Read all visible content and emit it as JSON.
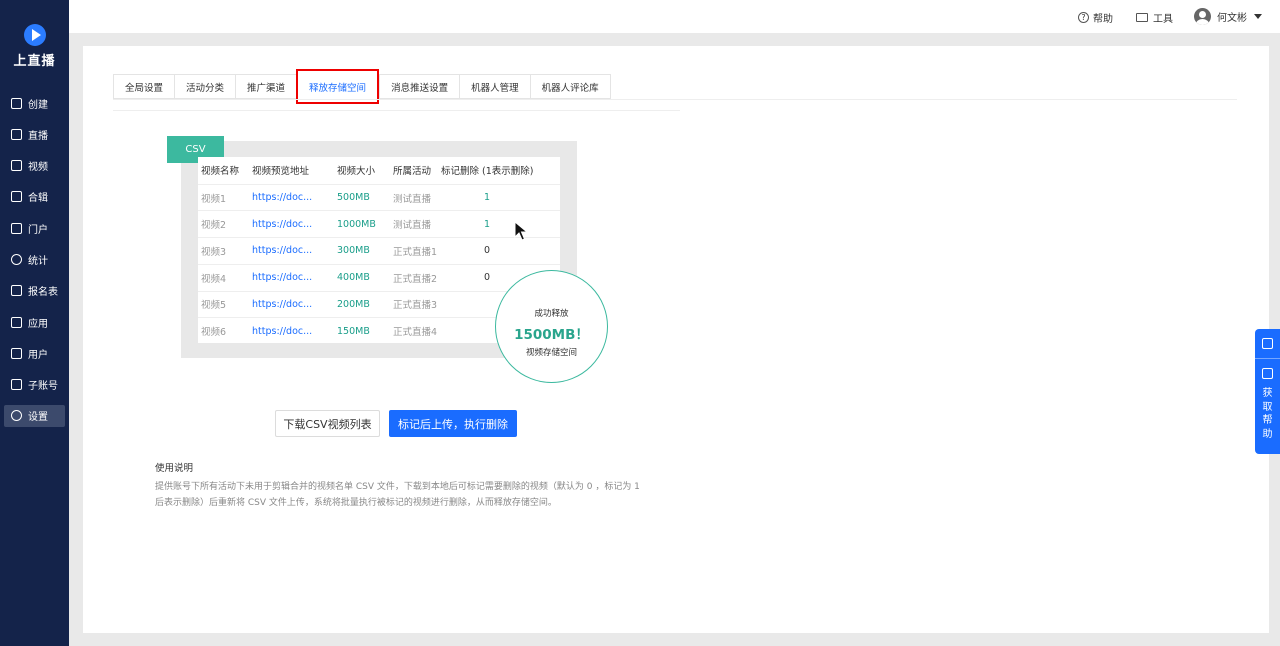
{
  "app": {
    "logo_text": "上直播"
  },
  "sidebar": {
    "items": [
      {
        "label": "创建",
        "icon": "plus-square-icon"
      },
      {
        "label": "直播",
        "icon": "video-camera-icon"
      },
      {
        "label": "视频",
        "icon": "film-icon"
      },
      {
        "label": "合辑",
        "icon": "collection-icon"
      },
      {
        "label": "门户",
        "icon": "monitor-icon"
      },
      {
        "label": "统计",
        "icon": "pie-chart-icon"
      },
      {
        "label": "报名表",
        "icon": "form-icon"
      },
      {
        "label": "应用",
        "icon": "apps-grid-icon"
      },
      {
        "label": "用户",
        "icon": "user-icon"
      },
      {
        "label": "子账号",
        "icon": "sub-account-icon"
      },
      {
        "label": "设置",
        "icon": "gear-icon",
        "active": true
      }
    ]
  },
  "topbar": {
    "help": "帮助",
    "tools": "工具",
    "user": "何文彬"
  },
  "tabs": [
    "全局设置",
    "活动分类",
    "推广渠道",
    "释放存储空间",
    "消息推送设置",
    "机器人管理",
    "机器人评论库"
  ],
  "active_tab": "释放存储空间",
  "illustration": {
    "tag": "CSV",
    "headers": [
      "视频名称",
      "视频预览地址",
      "视频大小",
      "所属活动",
      "标记删除 (1表示删除)"
    ],
    "rows": [
      [
        "视频1",
        "https://doc...",
        "500MB",
        "测试直播",
        "1"
      ],
      [
        "视频2",
        "https://doc...",
        "1000MB",
        "测试直播",
        "1"
      ],
      [
        "视频3",
        "https://doc...",
        "300MB",
        "正式直播1",
        "0"
      ],
      [
        "视频4",
        "https://doc...",
        "400MB",
        "正式直播2",
        "0"
      ],
      [
        "视频5",
        "https://doc...",
        "200MB",
        "正式直播3",
        ""
      ],
      [
        "视频6",
        "https://doc...",
        "150MB",
        "正式直播4",
        ""
      ]
    ],
    "success": {
      "line1": "成功释放",
      "amount": "1500MB！",
      "line3": "视频存储空间"
    }
  },
  "buttons": {
    "download": "下载CSV视频列表",
    "upload": "标记后上传，执行删除"
  },
  "help": {
    "title": "使用说明",
    "text": "提供账号下所有活动下未用于剪辑合并的视频名单 CSV 文件，下载到本地后可标记需要删除的视频（默认为 0 ，标记为 1 后表示删除）后重新将 CSV 文件上传，系统将批量执行被标记的视频进行删除，从而释放存储空间。"
  },
  "float_help": {
    "label": "获取帮助"
  },
  "colors": {
    "sidebar": "#14234a",
    "accent": "#1a6cff",
    "teal": "#3cb99f",
    "highlight": "#e00000"
  }
}
